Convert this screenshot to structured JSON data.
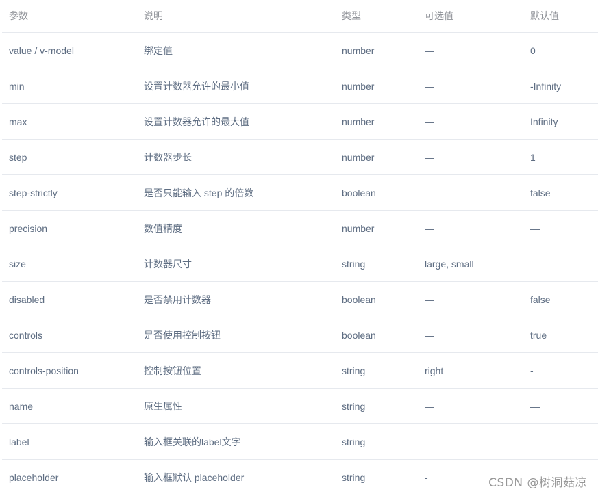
{
  "table": {
    "headers": [
      "参数",
      "说明",
      "类型",
      "可选值",
      "默认值"
    ],
    "rows": [
      [
        "value / v-model",
        "绑定值",
        "number",
        "—",
        "0"
      ],
      [
        "min",
        "设置计数器允许的最小值",
        "number",
        "—",
        "-Infinity"
      ],
      [
        "max",
        "设置计数器允许的最大值",
        "number",
        "—",
        "Infinity"
      ],
      [
        "step",
        "计数器步长",
        "number",
        "—",
        "1"
      ],
      [
        "step-strictly",
        "是否只能输入 step 的倍数",
        "boolean",
        "—",
        "false"
      ],
      [
        "precision",
        "数值精度",
        "number",
        "—",
        "—"
      ],
      [
        "size",
        "计数器尺寸",
        "string",
        "large, small",
        "—"
      ],
      [
        "disabled",
        "是否禁用计数器",
        "boolean",
        "—",
        "false"
      ],
      [
        "controls",
        "是否使用控制按钮",
        "boolean",
        "—",
        "true"
      ],
      [
        "controls-position",
        "控制按钮位置",
        "string",
        "right",
        "-"
      ],
      [
        "name",
        "原生属性",
        "string",
        "—",
        "—"
      ],
      [
        "label",
        "输入框关联的label文字",
        "string",
        "—",
        "—"
      ],
      [
        "placeholder",
        "输入框默认 placeholder",
        "string",
        "-",
        ""
      ]
    ]
  },
  "watermark": "CSDN @树洞菇凉"
}
